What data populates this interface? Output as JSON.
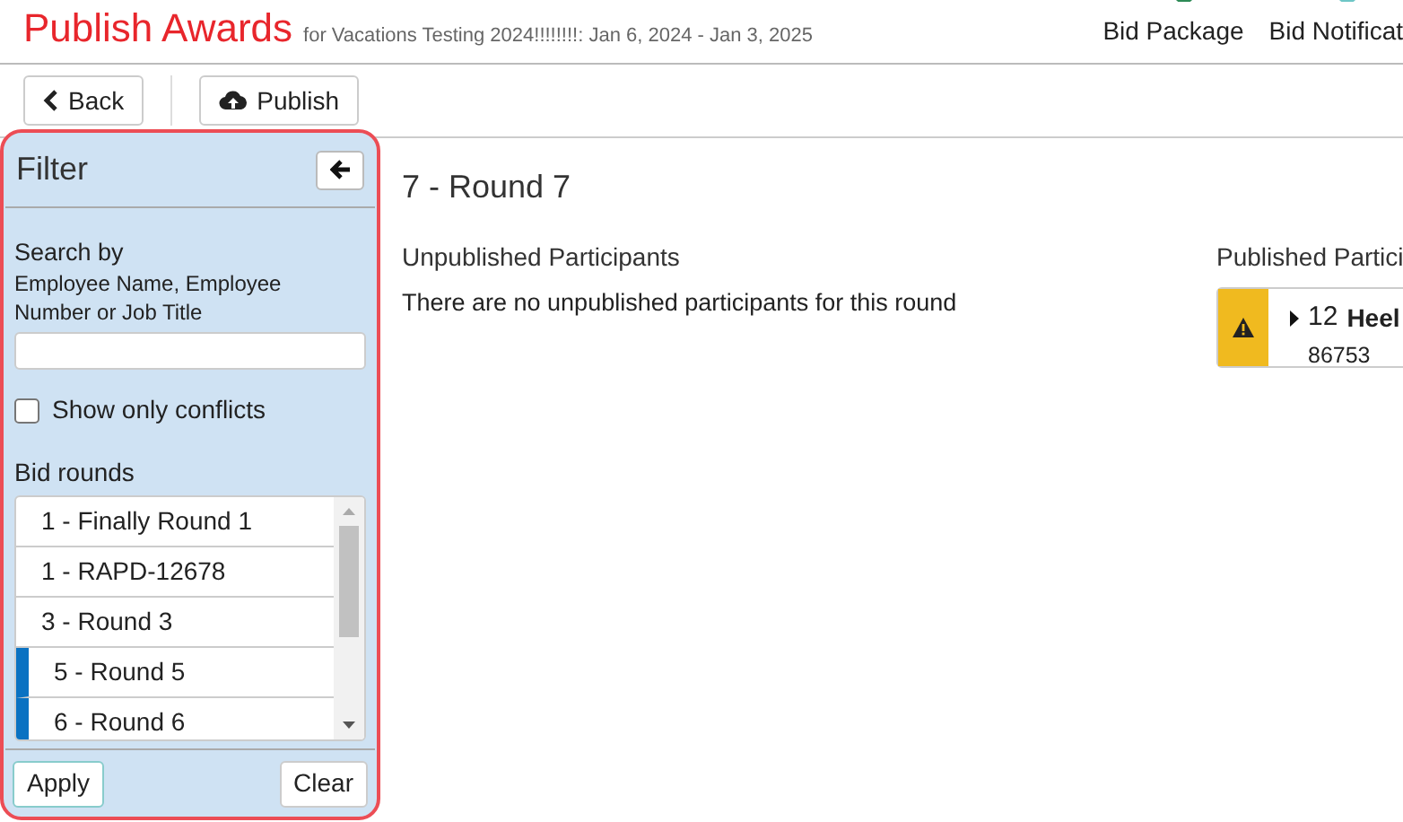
{
  "header": {
    "title": "Publish Awards",
    "subtitle": "for Vacations Testing 2024!!!!!!!!: Jan 6, 2024 - Jan 3, 2025",
    "nav": [
      "Bid Package",
      "Bid Notificat"
    ]
  },
  "toolbar": {
    "buttons": [
      {
        "kind": "back",
        "label": "Back"
      },
      {
        "kind": "publish",
        "label": "Publish"
      }
    ]
  },
  "filter": {
    "title": "Filter",
    "search_label": "Search by",
    "search_hint": "Employee Name, Employee Number or Job Title",
    "show_only_conflicts": {
      "label": "Show only conflicts",
      "checked": false
    },
    "rounds_label": "Bid rounds",
    "rounds": [
      {
        "label": "1 - Finally Round 1",
        "selected": false
      },
      {
        "label": "1 - RAPD-12678",
        "selected": false
      },
      {
        "label": "3 - Round 3",
        "selected": false
      },
      {
        "label": "5 - Round 5",
        "selected": true
      },
      {
        "label": "6 - Round 6",
        "selected": true
      }
    ],
    "apply": "Apply",
    "clear": "Clear"
  },
  "round": {
    "title": "7 - Round 7",
    "unpublished_heading": "Unpublished Participants",
    "unpublished_empty": "There are no unpublished participants for this round",
    "published_heading": "Published Partici",
    "published": [
      {
        "rank": "12",
        "name": "Heel",
        "number": "86753",
        "warning": true
      }
    ]
  }
}
